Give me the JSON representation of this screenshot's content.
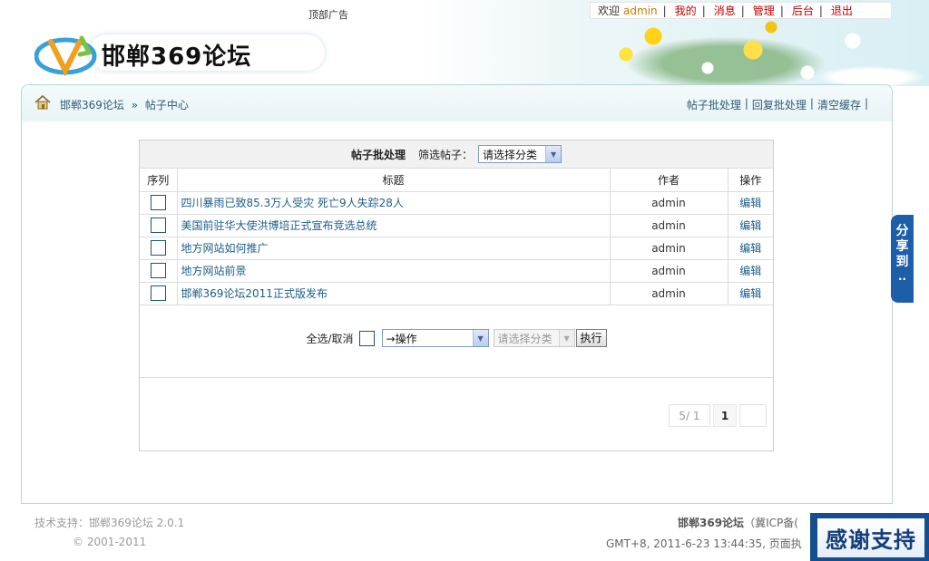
{
  "header": {
    "top_ad": "顶部广告",
    "welcome": "欢迎",
    "username": "admin",
    "links": [
      "我的",
      "消息",
      "管理",
      "后台",
      "退出"
    ],
    "logo_text": "邯郸369论坛"
  },
  "nav": {
    "breadcrumb_home": "邯郸369论坛",
    "breadcrumb_arrow": "»",
    "breadcrumb_current": "帖子中心",
    "actions": [
      "帖子批处理",
      "回复批处理",
      "清空缓存"
    ]
  },
  "panel": {
    "title": "帖子批处理",
    "filter_label": "筛选帖子：",
    "filter_select": "请选择分类",
    "columns": [
      "序列",
      "标题",
      "作者",
      "操作"
    ],
    "rows": [
      {
        "title": "四川暴雨已致85.3万人受灾 死亡9人失踪28人",
        "author": "admin",
        "op": "编辑"
      },
      {
        "title": "美国前驻华大使洪博培正式宣布竞选总统",
        "author": "admin",
        "op": "编辑"
      },
      {
        "title": "地方网站如何推广",
        "author": "admin",
        "op": "编辑"
      },
      {
        "title": "地方网站前景",
        "author": "admin",
        "op": "编辑"
      },
      {
        "title": "邯郸369论坛2011正式版发布",
        "author": "admin",
        "op": "编辑"
      }
    ],
    "bulk_label": "全选/取消",
    "op_select": "→操作",
    "category_select": "请选择分类",
    "exec_button": "执行",
    "pager_info": "5/ 1",
    "pager_current": "1"
  },
  "footer": {
    "support": "技术支持：邯郸369论坛 2.0.1",
    "copyright": "© 2001-2011",
    "site_name": "邯郸369论坛",
    "icp": "（冀ICP备(",
    "time_line": "GMT+8, 2011-6-23 13:44:35, 页面执"
  },
  "thanks": "感谢支持",
  "share": {
    "chars": [
      "分",
      "享",
      "到"
    ],
    "dots": "··"
  }
}
